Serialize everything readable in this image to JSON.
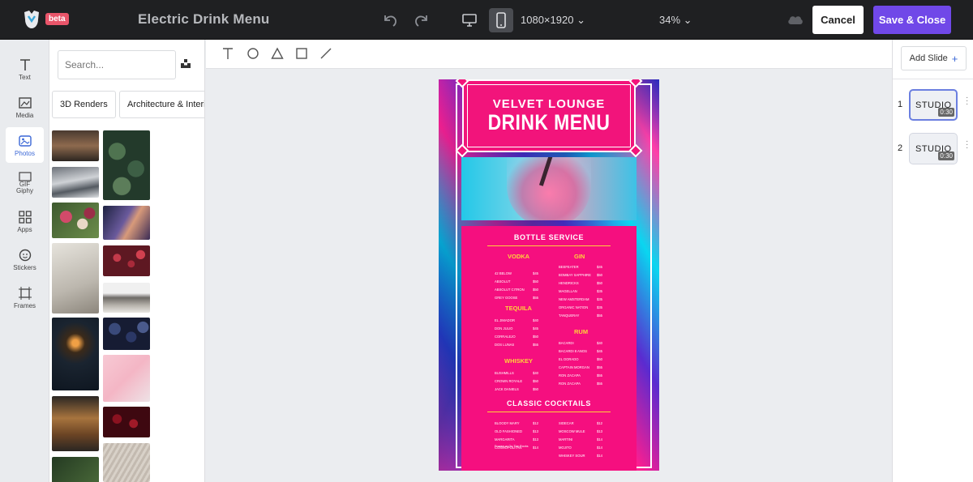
{
  "app": {
    "badge": "beta",
    "document_title": "Electric Drink Menu"
  },
  "toolbar": {
    "size_label": "1080×1920",
    "zoom_label": "34%",
    "cancel_label": "Cancel",
    "save_label": "Save & Close"
  },
  "rail": {
    "items": [
      {
        "label": "Text",
        "icon": "text-icon"
      },
      {
        "label": "Media",
        "icon": "media-icon"
      },
      {
        "label": "Photos",
        "icon": "photos-icon",
        "active": true
      },
      {
        "label": "GIF\nGiphy",
        "icon": "gif-icon"
      },
      {
        "label": "Apps",
        "icon": "apps-icon"
      },
      {
        "label": "Stickers",
        "icon": "stickers-icon"
      },
      {
        "label": "Frames",
        "icon": "frames-icon"
      }
    ],
    "labels": {
      "text": "Text",
      "media": "Media",
      "photos": "Photos",
      "gif": "GIF",
      "giphy": "Giphy",
      "apps": "Apps",
      "stickers": "Stickers",
      "frames": "Frames"
    }
  },
  "panel": {
    "search_placeholder": "Search...",
    "chips": [
      "3D Renders",
      "Architecture & Interiors"
    ]
  },
  "slides": {
    "add_label": "Add Slide",
    "items": [
      {
        "number": "1",
        "label": "STUDIO",
        "duration": "0:30",
        "selected": true
      },
      {
        "number": "2",
        "label": "STUDIO",
        "duration": "0:30",
        "selected": false
      }
    ]
  },
  "design": {
    "subtitle": "VELVET LOUNGE",
    "title": "DRINK MENU",
    "bottle_service": "BOTTLE SERVICE",
    "cocktails_title": "CLASSIC COCKTAILS",
    "colors": {
      "accent": "#7048e8",
      "menu_pink": "#f50f7f",
      "gold": "#ffd23a"
    },
    "vodka": {
      "title": "VODKA",
      "items": [
        {
          "name": "42 BELOW",
          "price": "$45"
        },
        {
          "name": "ABSOLUT",
          "price": "$50"
        },
        {
          "name": "ABSOLUT CITRON",
          "price": "$50"
        },
        {
          "name": "GREY GOOSE",
          "price": "$55"
        }
      ]
    },
    "tequila": {
      "title": "TEQUILA",
      "items": [
        {
          "name": "EL JIMADOR",
          "price": "$40"
        },
        {
          "name": "DON JULIO",
          "price": "$45"
        },
        {
          "name": "CORRALEJO",
          "price": "$50"
        },
        {
          "name": "DOS LUNAS",
          "price": "$55"
        }
      ]
    },
    "whiskey": {
      "title": "WHISKEY",
      "items": [
        {
          "name": "BUSHMILLS",
          "price": "$40"
        },
        {
          "name": "CROWN ROYALE",
          "price": "$50"
        },
        {
          "name": "JACK DANIELS",
          "price": "$50"
        }
      ]
    },
    "gin": {
      "title": "GIN",
      "items": [
        {
          "name": "BEEFEATER",
          "price": "$45"
        },
        {
          "name": "BOMBAY SAPPHIRE",
          "price": "$50"
        },
        {
          "name": "HENDRICKS",
          "price": "$50"
        },
        {
          "name": "MAGELLAN",
          "price": "$35"
        },
        {
          "name": "NEW AMSTERDAM",
          "price": "$35"
        },
        {
          "name": "ORGANIC NATION",
          "price": "$35"
        },
        {
          "name": "TANQUERAY",
          "price": "$55"
        }
      ]
    },
    "rum": {
      "title": "RUM",
      "items": [
        {
          "name": "BACARDI",
          "price": "$40"
        },
        {
          "name": "BACARDI 8 ANOS",
          "price": "$45"
        },
        {
          "name": "EL DORADO",
          "price": "$50"
        },
        {
          "name": "CAPTAIN MORGAN",
          "price": "$55"
        },
        {
          "name": "RON ZACAPA",
          "price": "$55"
        },
        {
          "name": "RON ZACAPA",
          "price": "$55"
        }
      ]
    },
    "cocktails_left": {
      "items": [
        {
          "name": "BLOODY MARY",
          "price": "$12"
        },
        {
          "name": "OLD FASHIONED",
          "price": "$13"
        },
        {
          "name": "MARGARITA",
          "price": "$13"
        },
        {
          "name": "COSMOPOLITAN",
          "price": "$14"
        }
      ],
      "note": "Frozen or On The Rocks"
    },
    "cocktails_right": {
      "items": [
        {
          "name": "SIDECAR",
          "price": "$12"
        },
        {
          "name": "MOSCOW MULE",
          "price": "$13"
        },
        {
          "name": "MARTINI",
          "price": "$14"
        },
        {
          "name": "MOJITO",
          "price": "$14"
        },
        {
          "name": "WHISKEY SOUR",
          "price": "$14"
        }
      ]
    }
  }
}
